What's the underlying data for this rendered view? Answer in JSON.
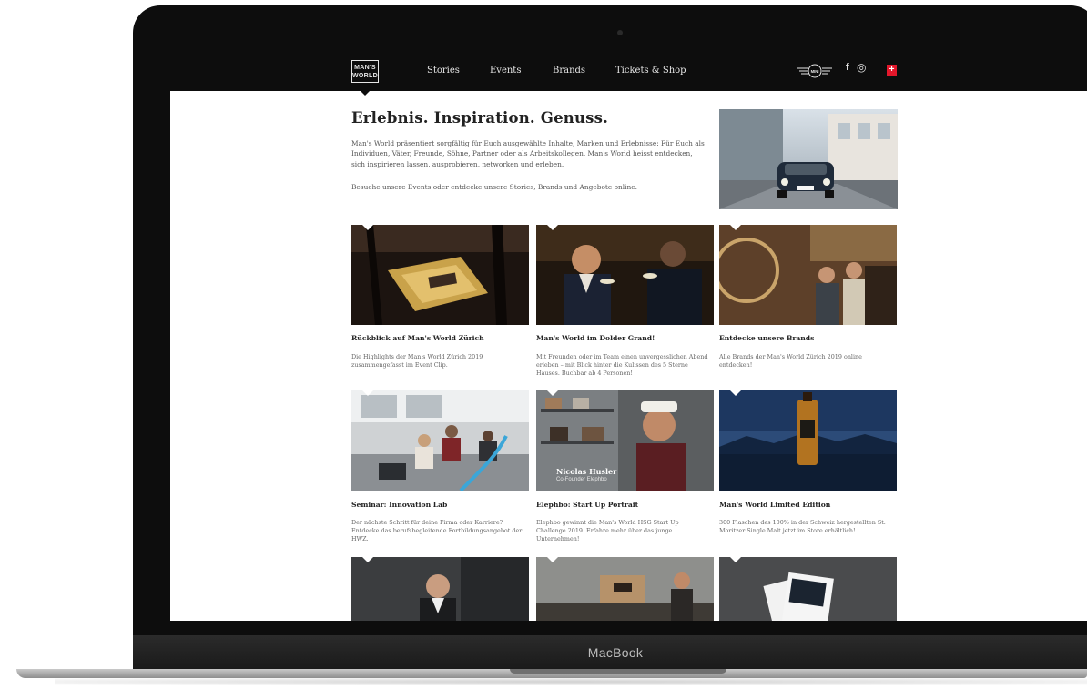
{
  "laptop": {
    "brand_label": "MacBook"
  },
  "header": {
    "logo_text": "MAN'S WORLD",
    "nav": [
      "Stories",
      "Events",
      "Brands",
      "Tickets & Shop"
    ],
    "mini_label": "MINI",
    "facebook": "f",
    "instagram": "◎",
    "flag_symbol": "+"
  },
  "intro": {
    "title": "Erlebnis. Inspiration. Genuss.",
    "paragraph1": "Man's World präsentiert sorgfältig für Euch ausgewählte Inhalte, Marken und Erlebnisse: Für Euch als Individuen, Väter, Freunde, Söhne, Partner oder als Arbeitskollegen. Man's World heisst entdecken, sich inspirieren lassen, ausprobieren, networken und erleben.",
    "paragraph2": "Besuche unsere Events oder entdecke unsere Stories, Brands und Angebote online."
  },
  "cards": [
    {
      "title": "Rückblick auf Man's World Zürich",
      "text": "Die Highlights der Man's World Zürich 2019 zusammengefasst im Event Clip."
    },
    {
      "title": "Man's World im Dolder Grand!",
      "text": "Mit Freunden oder im Team einen unvergesslichen Abend erleben – mit Blick hinter die Kulissen des 5 Sterne Hauses. Buchbar ab 4 Personen!"
    },
    {
      "title": "Entdecke unsere Brands",
      "text": "Alle Brands der Man's World Zürich 2019 online entdecken!"
    },
    {
      "title": "Seminar: Innovation Lab",
      "text": "Der nächste Schritt für deine Firma oder Karriere? Entdecke das berufsbegleitende Fortbildungsangebot der HWZ."
    },
    {
      "title": "Elephbo: Start Up Portrait",
      "text": "Elephbo gewinnt die Man's World HSG Start Up Challenge 2019. Erfahre mehr über das junge Unternehmen!"
    },
    {
      "title": "Man's World Limited Edition",
      "text": "300 Flaschen des 100% in der Schweiz hergestellten St. Moritzer Single Malt jetzt im Store erhältlich!"
    }
  ],
  "video_caption": {
    "name": "Nicolas Husler",
    "role": "Co-Founder Elephbo"
  },
  "colors": {
    "header_bg": "#0d0d0d",
    "flag_red": "#e3172b",
    "title_text": "#222222",
    "body_text": "#555555"
  }
}
